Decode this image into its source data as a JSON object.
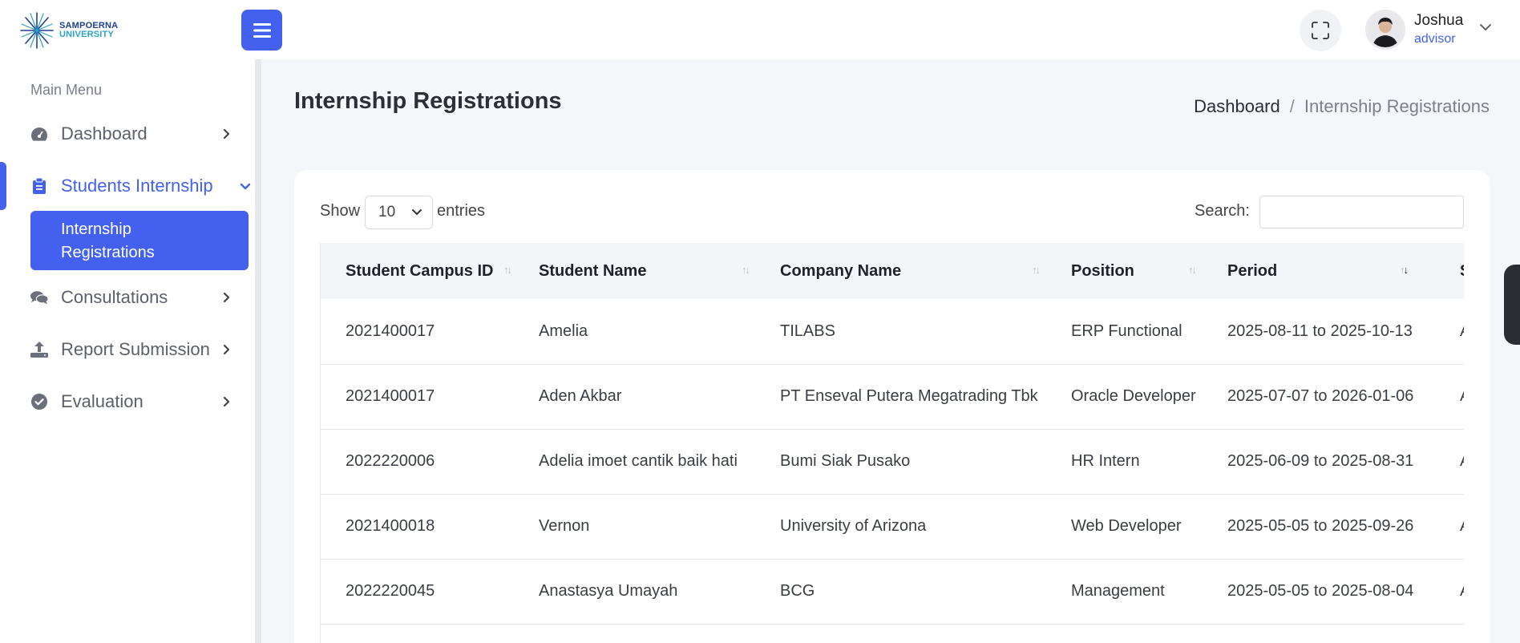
{
  "brand": {
    "line1": "SAMPOERNA",
    "line2": "UNIVERSITY"
  },
  "header": {
    "user_name": "Joshua",
    "user_role": "advisor"
  },
  "sidebar": {
    "heading": "Main Menu",
    "items": [
      {
        "label": "Dashboard",
        "icon": "gauge-icon"
      },
      {
        "label": "Students Internship",
        "icon": "clipboard-icon",
        "active": true
      },
      {
        "label": "Consultations",
        "icon": "chat-icon"
      },
      {
        "label": "Report Submission",
        "icon": "upload-icon"
      },
      {
        "label": "Evaluation",
        "icon": "check-circle-icon"
      }
    ],
    "sub_item": {
      "label": "Internship Registrations"
    }
  },
  "page": {
    "title": "Internship Registrations",
    "breadcrumb": {
      "home": "Dashboard",
      "sep": "/",
      "current": "Internship Registrations"
    }
  },
  "table_controls": {
    "show_label": "Show",
    "page_size": "10",
    "entries_label": "entries",
    "search_label": "Search:",
    "search_value": ""
  },
  "table": {
    "columns": [
      "Student Campus ID",
      "Student Name",
      "Company Name",
      "Position",
      "Period",
      "S"
    ],
    "rows": [
      [
        "2021400017",
        "Amelia",
        "TILABS",
        "ERP Functional",
        "2025-08-11 to 2025-10-13",
        "A"
      ],
      [
        "2021400017",
        "Aden Akbar",
        "PT Enseval Putera Megatrading Tbk",
        "Oracle Developer",
        "2025-07-07 to 2026-01-06",
        "A"
      ],
      [
        "2022220006",
        "Adelia imoet cantik baik hati",
        "Bumi Siak Pusako",
        "HR Intern",
        "2025-06-09 to 2025-08-31",
        "A"
      ],
      [
        "2021400018",
        "Vernon",
        "University of Arizona",
        "Web Developer",
        "2025-05-05 to 2025-09-26",
        "A"
      ],
      [
        "2022220045",
        "Anastasya Umayah",
        "BCG",
        "Management",
        "2025-05-05 to 2025-08-04",
        "A"
      ]
    ]
  },
  "colors": {
    "accent": "#4361ee",
    "text": "#2c2f36",
    "muted": "#7b808a"
  }
}
